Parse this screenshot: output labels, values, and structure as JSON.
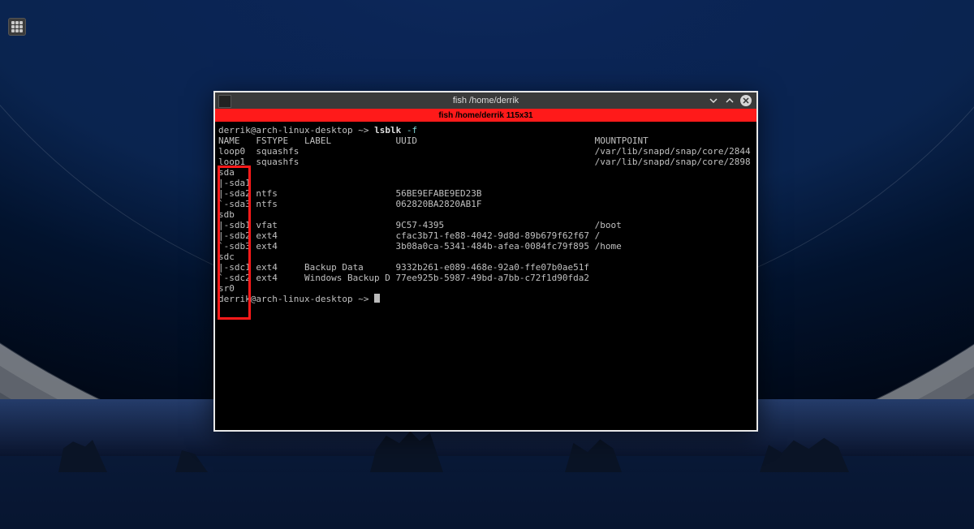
{
  "window": {
    "titlebar": "fish /home/derrik",
    "tabbar": "fish /home/derrik 115x31"
  },
  "prompt": {
    "user_host": "derrik@arch-linux-desktop",
    "sep": " ~> ",
    "cmd": "lsblk",
    "flag": "-f"
  },
  "prompt2": {
    "user_host": "derrik@arch-linux-desktop",
    "sep": " ~> "
  },
  "head": {
    "c0": "NAME",
    "c1": "FSTYPE",
    "c2": "LABEL",
    "c3": "UUID",
    "c4": "MOUNTPOINT"
  },
  "rows": [
    {
      "c0": "loop0",
      "c1": "squashfs",
      "c2": "",
      "c3": "",
      "c4": "/var/lib/snapd/snap/core/2844"
    },
    {
      "c0": "loop1",
      "c1": "squashfs",
      "c2": "",
      "c3": "",
      "c4": "/var/lib/snapd/snap/core/2898"
    },
    {
      "c0": "sda",
      "c1": "",
      "c2": "",
      "c3": "",
      "c4": ""
    },
    {
      "c0": "|-sda1",
      "c1": "",
      "c2": "",
      "c3": "",
      "c4": ""
    },
    {
      "c0": "|-sda2",
      "c1": "ntfs",
      "c2": "",
      "c3": "56BE9EFABE9ED23B",
      "c4": ""
    },
    {
      "c0": "`-sda3",
      "c1": "ntfs",
      "c2": "",
      "c3": "062820BA2820AB1F",
      "c4": ""
    },
    {
      "c0": "sdb",
      "c1": "",
      "c2": "",
      "c3": "",
      "c4": ""
    },
    {
      "c0": "|-sdb1",
      "c1": "vfat",
      "c2": "",
      "c3": "9C57-4395",
      "c4": "/boot"
    },
    {
      "c0": "|-sdb2",
      "c1": "ext4",
      "c2": "",
      "c3": "cfac3b71-fe88-4042-9d8d-89b679f62f67",
      "c4": "/"
    },
    {
      "c0": "`-sdb3",
      "c1": "ext4",
      "c2": "",
      "c3": "3b08a0ca-5341-484b-afea-0084fc79f895",
      "c4": "/home"
    },
    {
      "c0": "sdc",
      "c1": "",
      "c2": "",
      "c3": "",
      "c4": ""
    },
    {
      "c0": "|-sdc1",
      "c1": "ext4",
      "c2": "Backup Data",
      "c3": "9332b261-e089-468e-92a0-ffe07b0ae51f",
      "c4": ""
    },
    {
      "c0": "`-sdc2",
      "c1": "ext4",
      "c2": "Windows Backup D",
      "c3": "77ee925b-5987-49bd-a7bb-c72f1d90fda2",
      "c4": ""
    },
    {
      "c0": "sr0",
      "c1": "",
      "c2": "",
      "c3": "",
      "c4": ""
    }
  ],
  "widths": {
    "c0": 6,
    "c1": 8,
    "c2": 16,
    "c3": 36
  }
}
